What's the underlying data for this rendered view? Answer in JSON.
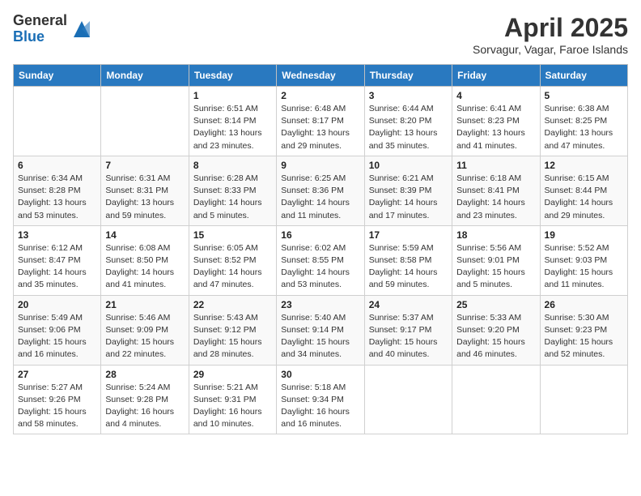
{
  "logo": {
    "general": "General",
    "blue": "Blue"
  },
  "title": "April 2025",
  "subtitle": "Sorvagur, Vagar, Faroe Islands",
  "days_of_week": [
    "Sunday",
    "Monday",
    "Tuesday",
    "Wednesday",
    "Thursday",
    "Friday",
    "Saturday"
  ],
  "weeks": [
    [
      {
        "day": "",
        "info": ""
      },
      {
        "day": "",
        "info": ""
      },
      {
        "day": "1",
        "info": "Sunrise: 6:51 AM\nSunset: 8:14 PM\nDaylight: 13 hours and 23 minutes."
      },
      {
        "day": "2",
        "info": "Sunrise: 6:48 AM\nSunset: 8:17 PM\nDaylight: 13 hours and 29 minutes."
      },
      {
        "day": "3",
        "info": "Sunrise: 6:44 AM\nSunset: 8:20 PM\nDaylight: 13 hours and 35 minutes."
      },
      {
        "day": "4",
        "info": "Sunrise: 6:41 AM\nSunset: 8:23 PM\nDaylight: 13 hours and 41 minutes."
      },
      {
        "day": "5",
        "info": "Sunrise: 6:38 AM\nSunset: 8:25 PM\nDaylight: 13 hours and 47 minutes."
      }
    ],
    [
      {
        "day": "6",
        "info": "Sunrise: 6:34 AM\nSunset: 8:28 PM\nDaylight: 13 hours and 53 minutes."
      },
      {
        "day": "7",
        "info": "Sunrise: 6:31 AM\nSunset: 8:31 PM\nDaylight: 13 hours and 59 minutes."
      },
      {
        "day": "8",
        "info": "Sunrise: 6:28 AM\nSunset: 8:33 PM\nDaylight: 14 hours and 5 minutes."
      },
      {
        "day": "9",
        "info": "Sunrise: 6:25 AM\nSunset: 8:36 PM\nDaylight: 14 hours and 11 minutes."
      },
      {
        "day": "10",
        "info": "Sunrise: 6:21 AM\nSunset: 8:39 PM\nDaylight: 14 hours and 17 minutes."
      },
      {
        "day": "11",
        "info": "Sunrise: 6:18 AM\nSunset: 8:41 PM\nDaylight: 14 hours and 23 minutes."
      },
      {
        "day": "12",
        "info": "Sunrise: 6:15 AM\nSunset: 8:44 PM\nDaylight: 14 hours and 29 minutes."
      }
    ],
    [
      {
        "day": "13",
        "info": "Sunrise: 6:12 AM\nSunset: 8:47 PM\nDaylight: 14 hours and 35 minutes."
      },
      {
        "day": "14",
        "info": "Sunrise: 6:08 AM\nSunset: 8:50 PM\nDaylight: 14 hours and 41 minutes."
      },
      {
        "day": "15",
        "info": "Sunrise: 6:05 AM\nSunset: 8:52 PM\nDaylight: 14 hours and 47 minutes."
      },
      {
        "day": "16",
        "info": "Sunrise: 6:02 AM\nSunset: 8:55 PM\nDaylight: 14 hours and 53 minutes."
      },
      {
        "day": "17",
        "info": "Sunrise: 5:59 AM\nSunset: 8:58 PM\nDaylight: 14 hours and 59 minutes."
      },
      {
        "day": "18",
        "info": "Sunrise: 5:56 AM\nSunset: 9:01 PM\nDaylight: 15 hours and 5 minutes."
      },
      {
        "day": "19",
        "info": "Sunrise: 5:52 AM\nSunset: 9:03 PM\nDaylight: 15 hours and 11 minutes."
      }
    ],
    [
      {
        "day": "20",
        "info": "Sunrise: 5:49 AM\nSunset: 9:06 PM\nDaylight: 15 hours and 16 minutes."
      },
      {
        "day": "21",
        "info": "Sunrise: 5:46 AM\nSunset: 9:09 PM\nDaylight: 15 hours and 22 minutes."
      },
      {
        "day": "22",
        "info": "Sunrise: 5:43 AM\nSunset: 9:12 PM\nDaylight: 15 hours and 28 minutes."
      },
      {
        "day": "23",
        "info": "Sunrise: 5:40 AM\nSunset: 9:14 PM\nDaylight: 15 hours and 34 minutes."
      },
      {
        "day": "24",
        "info": "Sunrise: 5:37 AM\nSunset: 9:17 PM\nDaylight: 15 hours and 40 minutes."
      },
      {
        "day": "25",
        "info": "Sunrise: 5:33 AM\nSunset: 9:20 PM\nDaylight: 15 hours and 46 minutes."
      },
      {
        "day": "26",
        "info": "Sunrise: 5:30 AM\nSunset: 9:23 PM\nDaylight: 15 hours and 52 minutes."
      }
    ],
    [
      {
        "day": "27",
        "info": "Sunrise: 5:27 AM\nSunset: 9:26 PM\nDaylight: 15 hours and 58 minutes."
      },
      {
        "day": "28",
        "info": "Sunrise: 5:24 AM\nSunset: 9:28 PM\nDaylight: 16 hours and 4 minutes."
      },
      {
        "day": "29",
        "info": "Sunrise: 5:21 AM\nSunset: 9:31 PM\nDaylight: 16 hours and 10 minutes."
      },
      {
        "day": "30",
        "info": "Sunrise: 5:18 AM\nSunset: 9:34 PM\nDaylight: 16 hours and 16 minutes."
      },
      {
        "day": "",
        "info": ""
      },
      {
        "day": "",
        "info": ""
      },
      {
        "day": "",
        "info": ""
      }
    ]
  ]
}
